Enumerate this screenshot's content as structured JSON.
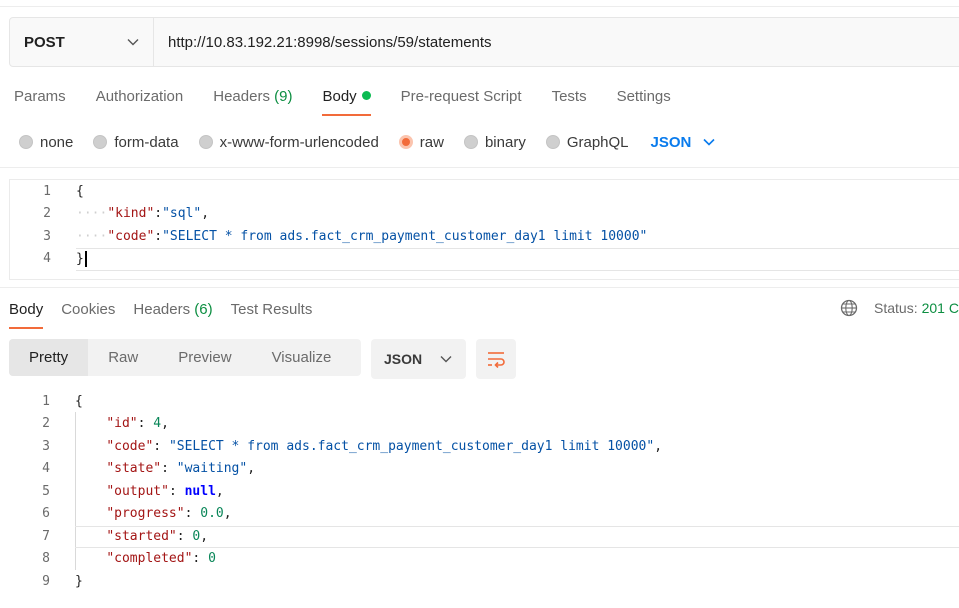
{
  "request": {
    "method": "POST",
    "url": "http://10.83.192.21:8998/sessions/59/statements"
  },
  "request_tabs": [
    {
      "label": "Params"
    },
    {
      "label": "Authorization"
    },
    {
      "label": "Headers",
      "count": "(9)"
    },
    {
      "label": "Body"
    },
    {
      "label": "Pre-request Script"
    },
    {
      "label": "Tests"
    },
    {
      "label": "Settings"
    }
  ],
  "body_types": {
    "none": "none",
    "form_data": "form-data",
    "urlencoded": "x-www-form-urlencoded",
    "raw": "raw",
    "binary": "binary",
    "graphql": "GraphQL",
    "language": "JSON",
    "selected": "raw"
  },
  "request_body": {
    "line_numbers": [
      "1",
      "2",
      "3",
      "4"
    ],
    "open": "{",
    "kind_key": "\"kind\"",
    "kind_val": "\"sql\"",
    "code_key": "\"code\"",
    "code_val": "\"SELECT * from ads.fact_crm_payment_customer_day1 limit 10000\"",
    "close": "}"
  },
  "response_tabs": [
    {
      "label": "Body"
    },
    {
      "label": "Cookies"
    },
    {
      "label": "Headers",
      "count": "(6)"
    },
    {
      "label": "Test Results"
    }
  ],
  "status": {
    "label": "Status:",
    "value": "201 C"
  },
  "view_modes": [
    "Pretty",
    "Raw",
    "Preview",
    "Visualize"
  ],
  "response_format": "JSON",
  "response_body": {
    "line_numbers": [
      "1",
      "2",
      "3",
      "4",
      "5",
      "6",
      "7",
      "8",
      "9"
    ],
    "open": "{",
    "id_key": "\"id\"",
    "id_val": "4",
    "code_key": "\"code\"",
    "code_val": "\"SELECT * from ads.fact_crm_payment_customer_day1 limit 10000\"",
    "state_key": "\"state\"",
    "state_val": "\"waiting\"",
    "output_key": "\"output\"",
    "output_val": "null",
    "progress_key": "\"progress\"",
    "progress_val": "0.0",
    "started_key": "\"started\"",
    "started_val": "0",
    "completed_key": "\"completed\"",
    "completed_val": "0",
    "close": "}"
  },
  "colors": {
    "accent": "#f26b3a",
    "link_blue": "#097bed",
    "success_green": "#0c8e41",
    "body_dot": "#0cbb52"
  },
  "icons": {
    "method_dropdown": "chevron-down-icon",
    "language_dropdown": "chevron-down-icon",
    "status_globe": "globe-icon",
    "wrap_lines": "wrap-lines-icon"
  }
}
